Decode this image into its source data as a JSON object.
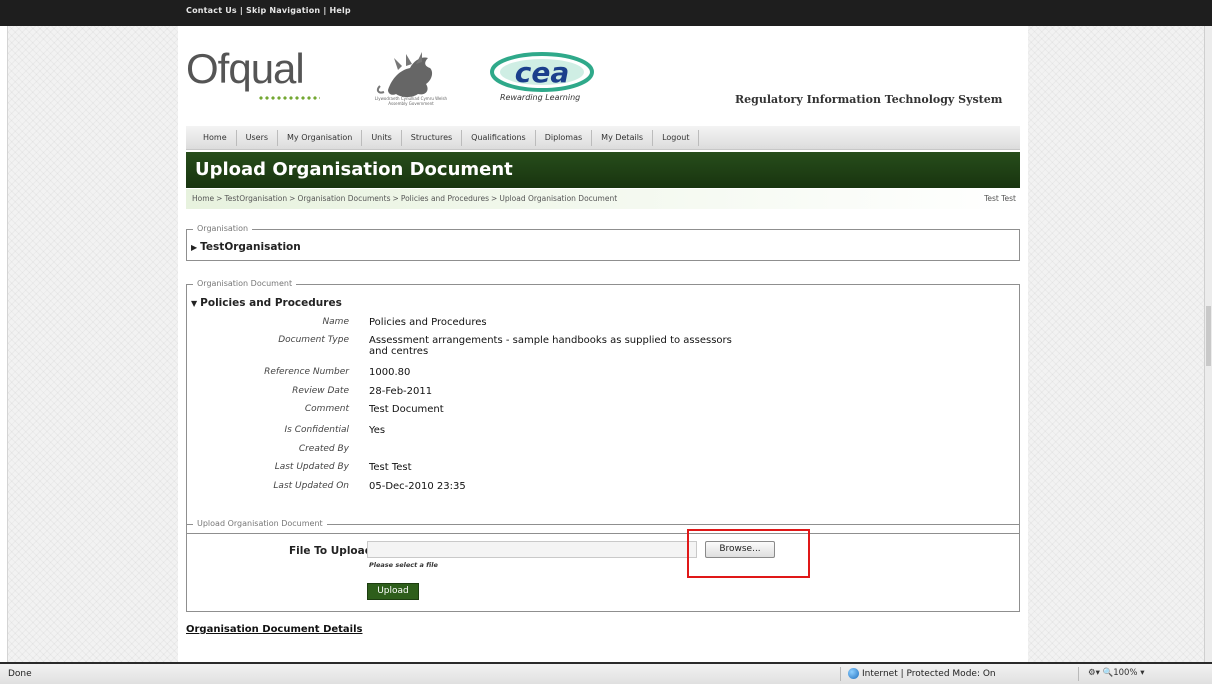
{
  "top_links": [
    "Contact Us",
    "Skip Navigation",
    "Help"
  ],
  "brand": {
    "ofqual": "Ofqual",
    "welsh_caption": "Llywodraeth Cynulliad Cymru Welsh Assembly Government",
    "cea_caption": "Rewarding Learning",
    "system_title": "Regulatory Information Technology System"
  },
  "nav": [
    "Home",
    "Users",
    "My Organisation",
    "Units",
    "Structures",
    "Qualifications",
    "Diplomas",
    "My Details",
    "Logout"
  ],
  "page_title": "Upload Organisation Document",
  "breadcrumb": [
    "Home",
    "TestOrganisation",
    "Organisation Documents",
    "Policies and Procedures",
    "Upload Organisation Document"
  ],
  "user": "Test Test",
  "organisation": {
    "legend": "Organisation",
    "name": "TestOrganisation"
  },
  "document": {
    "legend": "Organisation Document",
    "heading": "Policies and Procedures",
    "fields": [
      {
        "label": "Name",
        "value": "Policies and Procedures"
      },
      {
        "label": "Document Type",
        "value": "Assessment arrangements - sample handbooks as supplied to assessors and centres"
      },
      {
        "label": "Reference Number",
        "value": "1000.80"
      },
      {
        "label": "Review Date",
        "value": "28-Feb-2011"
      },
      {
        "label": "Comment",
        "value": "Test Document"
      },
      {
        "label": "Is Confidential",
        "value": "Yes"
      },
      {
        "label": "Created By",
        "value": ""
      },
      {
        "label": "Last Updated By",
        "value": "Test Test"
      },
      {
        "label": "Last Updated On",
        "value": "05-Dec-2010 23:35"
      }
    ]
  },
  "upload": {
    "legend": "Upload Organisation Document",
    "file_label": "File To Upload",
    "browse": "Browse...",
    "hint": "Please select a file",
    "upload_button": "Upload"
  },
  "details_link": "Organisation Document Details",
  "status": {
    "left": "Done",
    "zone": "Internet | Protected Mode: On",
    "zoom": "100%"
  },
  "colors": {
    "header_green": "#274d1b",
    "button_green": "#2e5e1b",
    "highlight_red": "#e01818"
  }
}
